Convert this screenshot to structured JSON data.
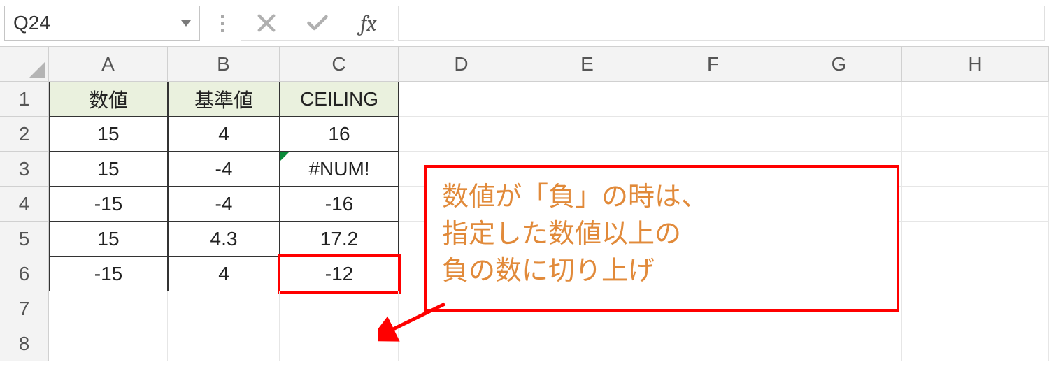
{
  "name_box": "Q24",
  "formula_input": "",
  "fx_label": "fx",
  "columns": [
    "A",
    "B",
    "C",
    "D",
    "E",
    "F",
    "G",
    "H"
  ],
  "rows": [
    "1",
    "2",
    "3",
    "4",
    "5",
    "6",
    "7",
    "8"
  ],
  "table": {
    "headers": {
      "a": "数値",
      "b": "基準値",
      "c": "CEILING"
    },
    "rows": [
      {
        "a": "15",
        "b": "4",
        "c": "16"
      },
      {
        "a": "15",
        "b": "-4",
        "c": "#NUM!"
      },
      {
        "a": "-15",
        "b": "-4",
        "c": "-16"
      },
      {
        "a": "15",
        "b": "4.3",
        "c": "17.2"
      },
      {
        "a": "-15",
        "b": "4",
        "c": "-12"
      }
    ]
  },
  "callout": {
    "line1": "数値が「負」の時は、",
    "line2": "指定した数値以上の",
    "line3": "負の数に切り上げ"
  },
  "chart_data": {
    "type": "table",
    "title": "CEILING function examples",
    "columns": [
      "数値",
      "基準値",
      "CEILING"
    ],
    "rows": [
      [
        15,
        4,
        16
      ],
      [
        15,
        -4,
        "#NUM!"
      ],
      [
        -15,
        -4,
        -16
      ],
      [
        15,
        4.3,
        17.2
      ],
      [
        -15,
        4,
        -12
      ]
    ]
  }
}
